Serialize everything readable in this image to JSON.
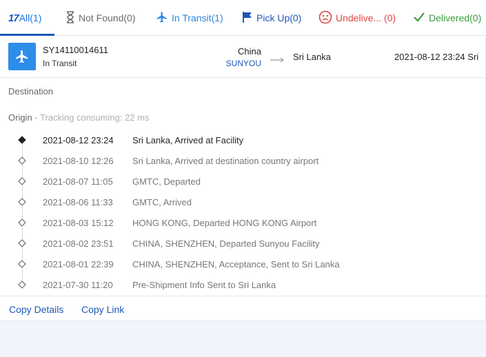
{
  "tabs": [
    {
      "logo": "17",
      "label": "All(1)"
    },
    {
      "label": "Not Found(0)"
    },
    {
      "label": "In Transit(1)"
    },
    {
      "label": "Pick Up(0)"
    },
    {
      "label": "Undelive... (0)"
    },
    {
      "label": "Delivered(0)"
    }
  ],
  "colors": {
    "accent": "#1f57b8",
    "in_transit": "#2d8de8",
    "undelivered": "#e24444",
    "delivered": "#3c9b3c",
    "not_found": "#6b6b6b"
  },
  "icons": {
    "not_found": "hourglass-icon",
    "in_transit": "airplane-icon",
    "pick_up": "flag-icon",
    "undelivered": "sad-face-icon",
    "delivered": "checkmark-icon",
    "status": "airplane-icon",
    "route": "arrow-right-icon"
  },
  "shipment": {
    "tracking_number": "SY14110014611",
    "status": "In Transit",
    "origin_country": "China",
    "carrier": "SUNYOU",
    "destination_country": "Sri Lanka",
    "last_update": "2021-08-12 23:24",
    "last_update_place": "Sri"
  },
  "sections": {
    "destination_label": "Destination",
    "origin_label": "Origin",
    "tracking_note": " - Tracking consuming: 22 ms"
  },
  "events": [
    {
      "time": "2021-08-12 23:24",
      "desc": "Sri Lanka, Arrived at Facility"
    },
    {
      "time": "2021-08-10 12:26",
      "desc": "Sri Lanka, Arrived at destination country airport"
    },
    {
      "time": "2021-08-07 11:05",
      "desc": "GMTC, Departed"
    },
    {
      "time": "2021-08-06 11:33",
      "desc": "GMTC, Arrived"
    },
    {
      "time": "2021-08-03 15:12",
      "desc": "HONG KONG, Departed HONG KONG Airport"
    },
    {
      "time": "2021-08-02 23:51",
      "desc": "CHINA, SHENZHEN, Departed Sunyou Facility"
    },
    {
      "time": "2021-08-01 22:39",
      "desc": "CHINA, SHENZHEN, Acceptance, Sent to Sri Lanka"
    },
    {
      "time": "2021-07-30 11:20",
      "desc": "Pre-Shipment Info Sent to Sri Lanka"
    }
  ],
  "footer": {
    "copy_details": "Copy Details",
    "copy_link": "Copy Link"
  }
}
